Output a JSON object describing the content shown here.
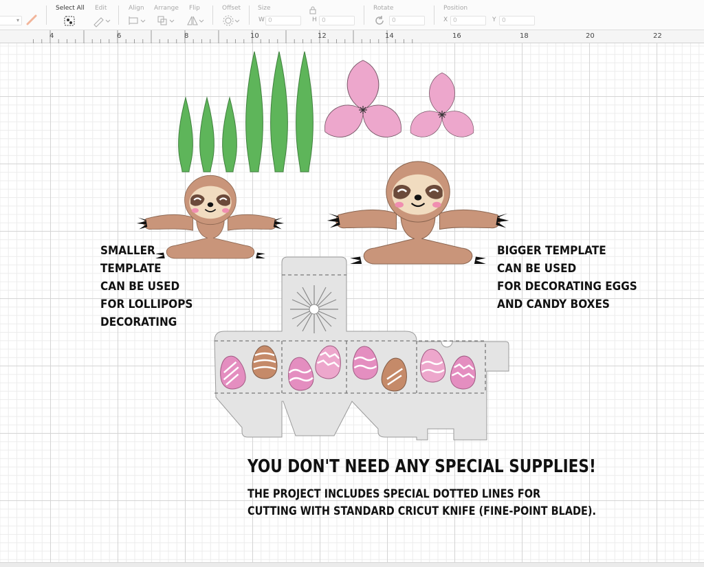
{
  "toolbar": {
    "select_all_label": "Select All",
    "edit_label": "Edit",
    "align_label": "Align",
    "arrange_label": "Arrange",
    "flip_label": "Flip",
    "offset_label": "Offset",
    "size_label": "Size",
    "size_w_label": "W",
    "size_w_value": "0",
    "size_h_label": "H",
    "size_h_value": "0",
    "rotate_label": "Rotate",
    "rotate_value": "0",
    "position_label": "Position",
    "pos_x_label": "X",
    "pos_x_value": "0",
    "pos_y_label": "Y",
    "pos_y_value": "0",
    "linetype_color": "#f2b59a"
  },
  "ruler": {
    "ticks": [
      "4",
      "6",
      "8",
      "10",
      "12",
      "14",
      "16",
      "18",
      "20",
      "22"
    ]
  },
  "canvas": {
    "note_small": [
      "SMALLER",
      "TEMPLATE",
      "CAN BE USED",
      "FOR LOLLIPOPS",
      "DECORATING"
    ],
    "note_big": [
      "BIGGER TEMPLATE",
      "CAN BE USED",
      "FOR DECORATING EGGS",
      "AND CANDY BOXES"
    ],
    "headline": "YOU DON'T NEED ANY SPECIAL SUPPLIES!",
    "subline": [
      "THE PROJECT INCLUDES SPECIAL DOTTED LINES FOR",
      "CUTTING WITH STANDARD CRICUT KNIFE (FINE-POINT BLADE)."
    ]
  },
  "colors": {
    "leaf": "#5eb55a",
    "petal": "#eda7cc",
    "sloth_body": "#c9957a",
    "sloth_face": "#f1dcc0",
    "box": "#e4e4e4",
    "egg_pink": "#e48ec0",
    "egg_brown": "#c58a69"
  }
}
